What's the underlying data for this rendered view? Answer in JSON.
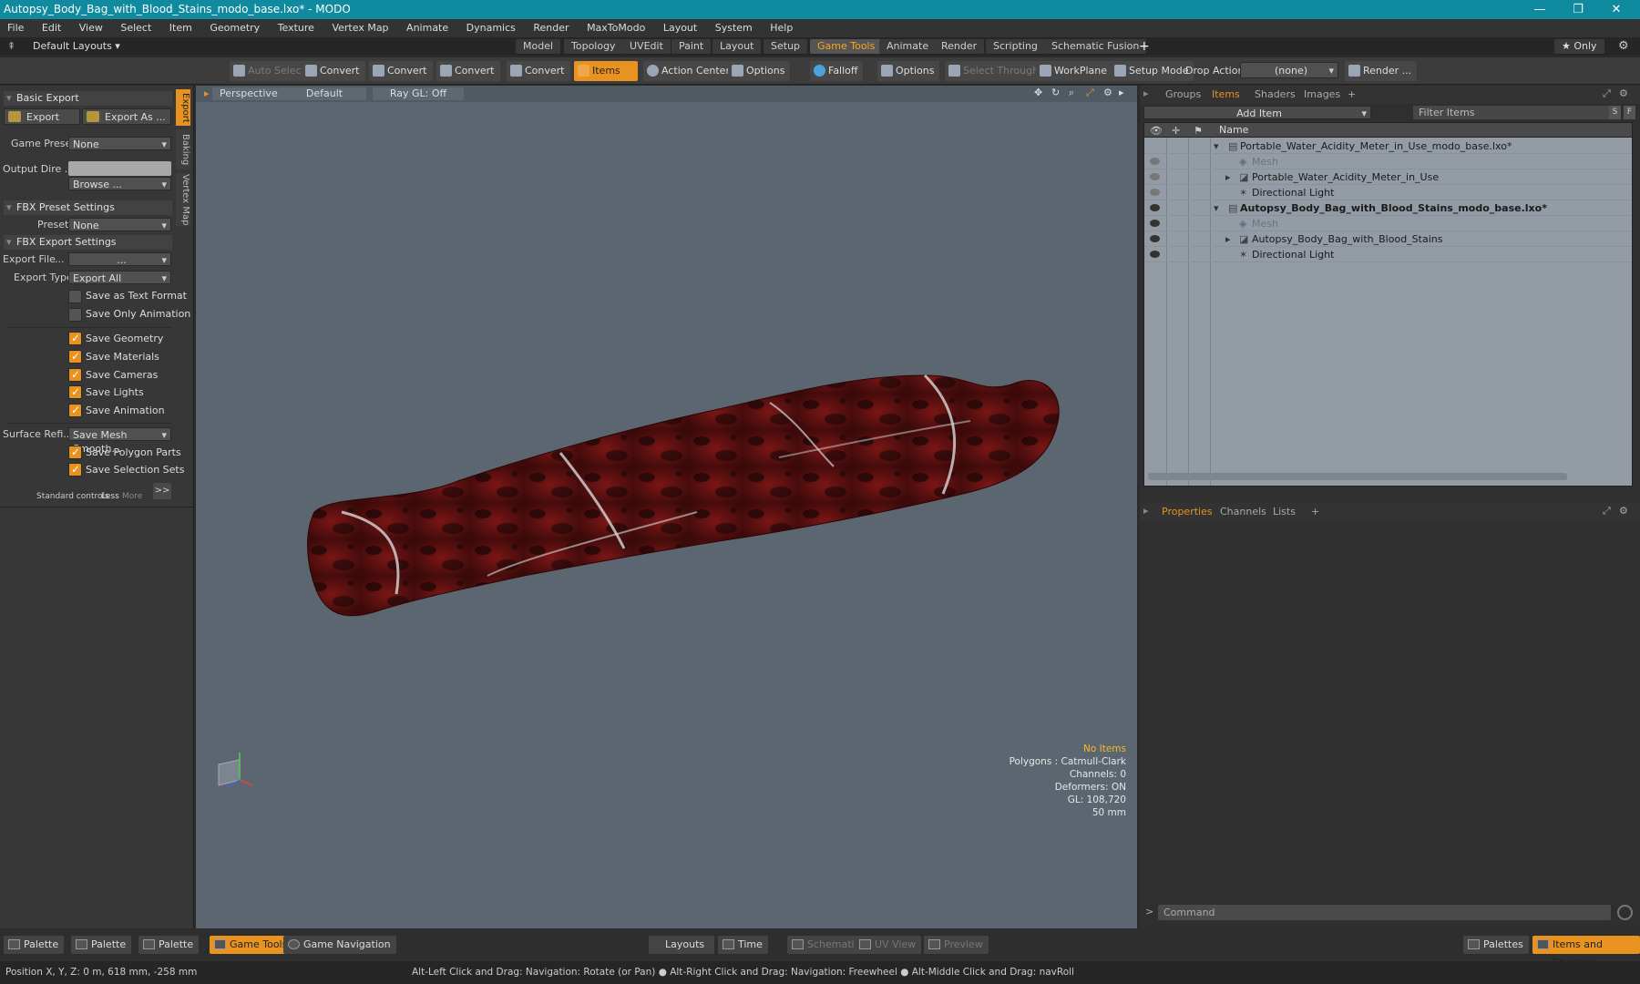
{
  "window": {
    "title": "Autopsy_Body_Bag_with_Blood_Stains_modo_base.lxo* - MODO",
    "minimize": "—",
    "restore": "❐",
    "close": "✕"
  },
  "menu": [
    "File",
    "Edit",
    "View",
    "Select",
    "Item",
    "Geometry",
    "Texture",
    "Vertex Map",
    "Animate",
    "Dynamics",
    "Render",
    "MaxToModo",
    "Layout",
    "System",
    "Help"
  ],
  "layout_bar": {
    "default_layouts": "Default Layouts ▾",
    "tabs": [
      "Model",
      "Topology",
      "UVEdit",
      "Paint",
      "Layout",
      "Setup",
      "Game Tools",
      "Animate",
      "Render",
      "Scripting",
      "Schematic Fusion"
    ],
    "active_tab": "Game Tools",
    "add": "+",
    "only": "★  Only"
  },
  "toolbar": {
    "auto_select": "Auto Select",
    "convert1": "Convert",
    "convert2": "Convert",
    "convert3": "Convert",
    "convert4": "Convert",
    "items": "Items",
    "action_center": "Action Center",
    "options1": "Options",
    "falloff": "Falloff",
    "options2": "Options",
    "select_through": "Select Through",
    "workplane": "WorkPlane",
    "setup_mode": "Setup Mode",
    "drop_action": "Drop Action",
    "none_select": "(none)",
    "render": "Render ..."
  },
  "left_panel": {
    "vtabs": [
      "Export",
      "Baking",
      "Vertex Map"
    ],
    "basic_export": "Basic Export",
    "export_btn": "Export",
    "export_as_btn": "Export As ...",
    "game_preset_label": "Game Preset",
    "game_preset_value": "None",
    "output_dir_label": "Output Dire ...",
    "browse": "Browse ...",
    "fbx_preset_settings": "FBX Preset Settings",
    "preset_label": "Preset",
    "preset_value": "None",
    "fbx_export_settings": "FBX Export Settings",
    "export_file_label": "Export File",
    "export_file_value": "...",
    "export_type_label": "Export Type",
    "export_type_value": "Export All",
    "checkboxes": [
      {
        "label": "Save as Text Format",
        "checked": false
      },
      {
        "label": "Save Only Animation",
        "checked": false
      },
      {
        "label": "Save Geometry",
        "checked": true
      },
      {
        "label": "Save Materials",
        "checked": true
      },
      {
        "label": "Save Cameras",
        "checked": true
      },
      {
        "label": "Save Lights",
        "checked": true
      },
      {
        "label": "Save Animation",
        "checked": true
      }
    ],
    "surface_label": "Surface Refi...",
    "surface_value": "Save Mesh Smooth...",
    "checkboxes2": [
      {
        "label": "Save Polygon Parts",
        "checked": true
      },
      {
        "label": "Save Selection Sets",
        "checked": true
      }
    ],
    "standard_controls": "Standard controls",
    "less": "Less",
    "more": "More",
    "expand": ">>"
  },
  "viewport": {
    "perspective": "Perspective",
    "default": "Default",
    "raygl": "Ray GL: Off",
    "info": [
      "No Items",
      "Polygons : Catmull-Clark",
      "Channels: 0",
      "Deformers: ON",
      "GL: 108,720",
      "50 mm"
    ]
  },
  "right_panel": {
    "tabs": [
      "Groups",
      "Items",
      "Shaders",
      "Images"
    ],
    "active_tab": "Items",
    "add_item": "Add Item",
    "filter_items": "Filter Items",
    "s": "S",
    "f": "F",
    "name_header": "Name",
    "items": [
      {
        "label": "Portable_Water_Acidity_Meter_in_Use_modo_base.lxo*",
        "bold": false
      },
      {
        "label": "Mesh",
        "bold": false
      },
      {
        "label": "Portable_Water_Acidity_Meter_in_Use",
        "bold": false
      },
      {
        "label": "Directional Light",
        "bold": false
      },
      {
        "label": "Autopsy_Body_Bag_with_Blood_Stains_modo_base.lxo*",
        "bold": true
      },
      {
        "label": "Mesh",
        "bold": false
      },
      {
        "label": "Autopsy_Body_Bag_with_Blood_Stains",
        "bold": false
      },
      {
        "label": "Directional Light",
        "bold": false
      }
    ],
    "prop_tabs": [
      "Properties",
      "Channels",
      "Lists"
    ],
    "prop_add": "+",
    "command_placeholder": "Command"
  },
  "bottom_bar": {
    "palette1": "Palette",
    "palette2": "Palette",
    "palette3": "Palette",
    "game_tools": "Game Tools",
    "game_navigation": "Game Navigation",
    "layouts": "Layouts",
    "time": "Time",
    "schematic": "Schematic",
    "uv_view": "UV View",
    "preview": "Preview",
    "palettes": "Palettes",
    "items_shading": "Items and Shading"
  },
  "status": {
    "position": "Position X, Y, Z:   0 m, 618 mm, -258 mm",
    "hint": "Alt-Left Click and Drag: Navigation: Rotate (or Pan) ● Alt-Right Click and Drag: Navigation: Freewheel ● Alt-Middle Click and Drag: navRoll"
  },
  "colors": {
    "accent": "#e8931f",
    "titlebar": "#0f8a9e",
    "viewport": "#5c6670",
    "bag": "#6e1414"
  }
}
